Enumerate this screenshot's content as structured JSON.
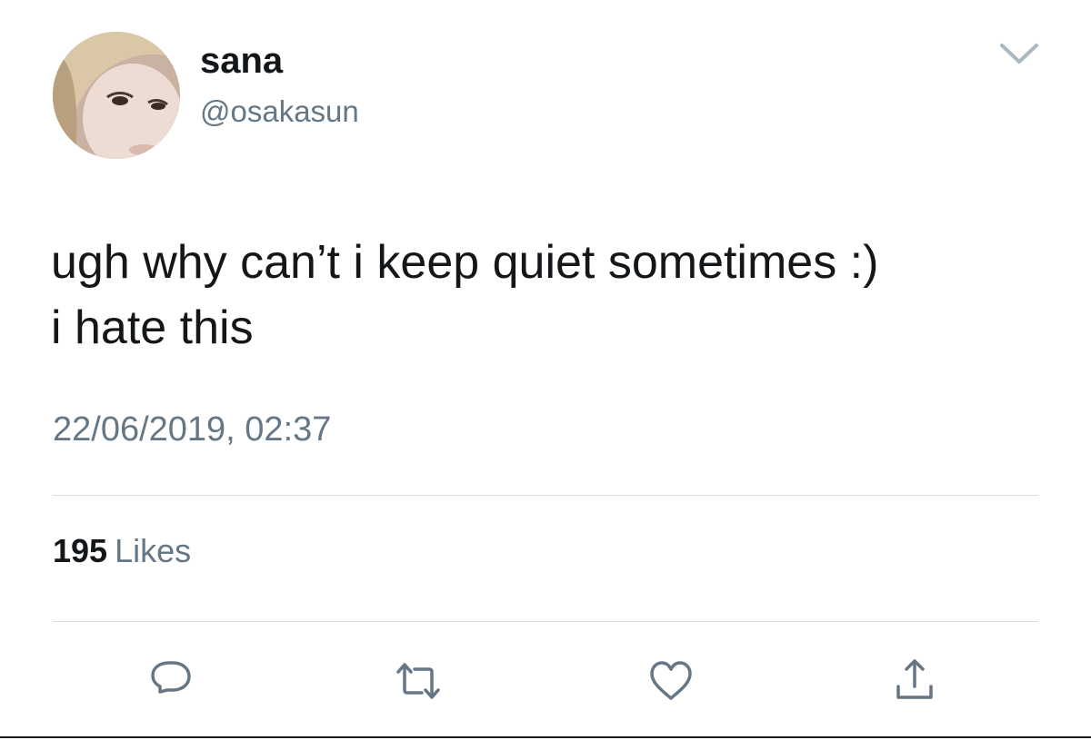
{
  "tweet": {
    "display_name": "sana",
    "handle": "@osakasun",
    "text": "ugh why can’t i keep quiet sometimes :)\ni hate this",
    "timestamp": "22/06/2019, 02:37",
    "likes_count": "195",
    "likes_label": "Likes"
  },
  "icons": {
    "menu": "chevron-down-icon",
    "reply": "reply-icon",
    "retweet": "retweet-icon",
    "like": "heart-icon",
    "share": "share-icon"
  },
  "colors": {
    "text_primary": "#14171a",
    "text_secondary": "#657786",
    "divider": "#d8dde2"
  }
}
